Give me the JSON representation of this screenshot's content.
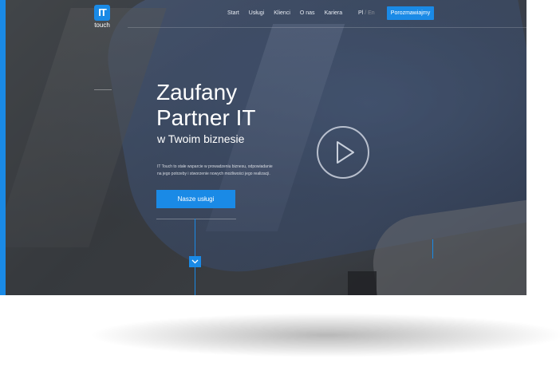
{
  "logo": {
    "mark": "IT",
    "word": "touch"
  },
  "nav": {
    "items": [
      "Start",
      "Usługi",
      "Klienci",
      "O nas",
      "Kariera"
    ]
  },
  "lang": {
    "active": "Pl",
    "separator": "/",
    "inactive": "En"
  },
  "cta_top": {
    "label": "Porozmawiajmy"
  },
  "hero": {
    "title_line1": "Zaufany",
    "title_line2": "Partner IT",
    "subtitle": "w Twoim biznesie",
    "description_line1": "IT Touch to stałe wsparcie w prowadzeniu biznesu, odpowiadanie",
    "description_line2": "na jego potrzeby i stworzenie nowych możliwości jego realizacji.",
    "button_label": "Nasze usługi"
  },
  "icons": {
    "play": "play-icon",
    "scroll": "chevron-down-icon"
  },
  "colors": {
    "accent": "#1a8ae6",
    "text": "#ffffff"
  }
}
